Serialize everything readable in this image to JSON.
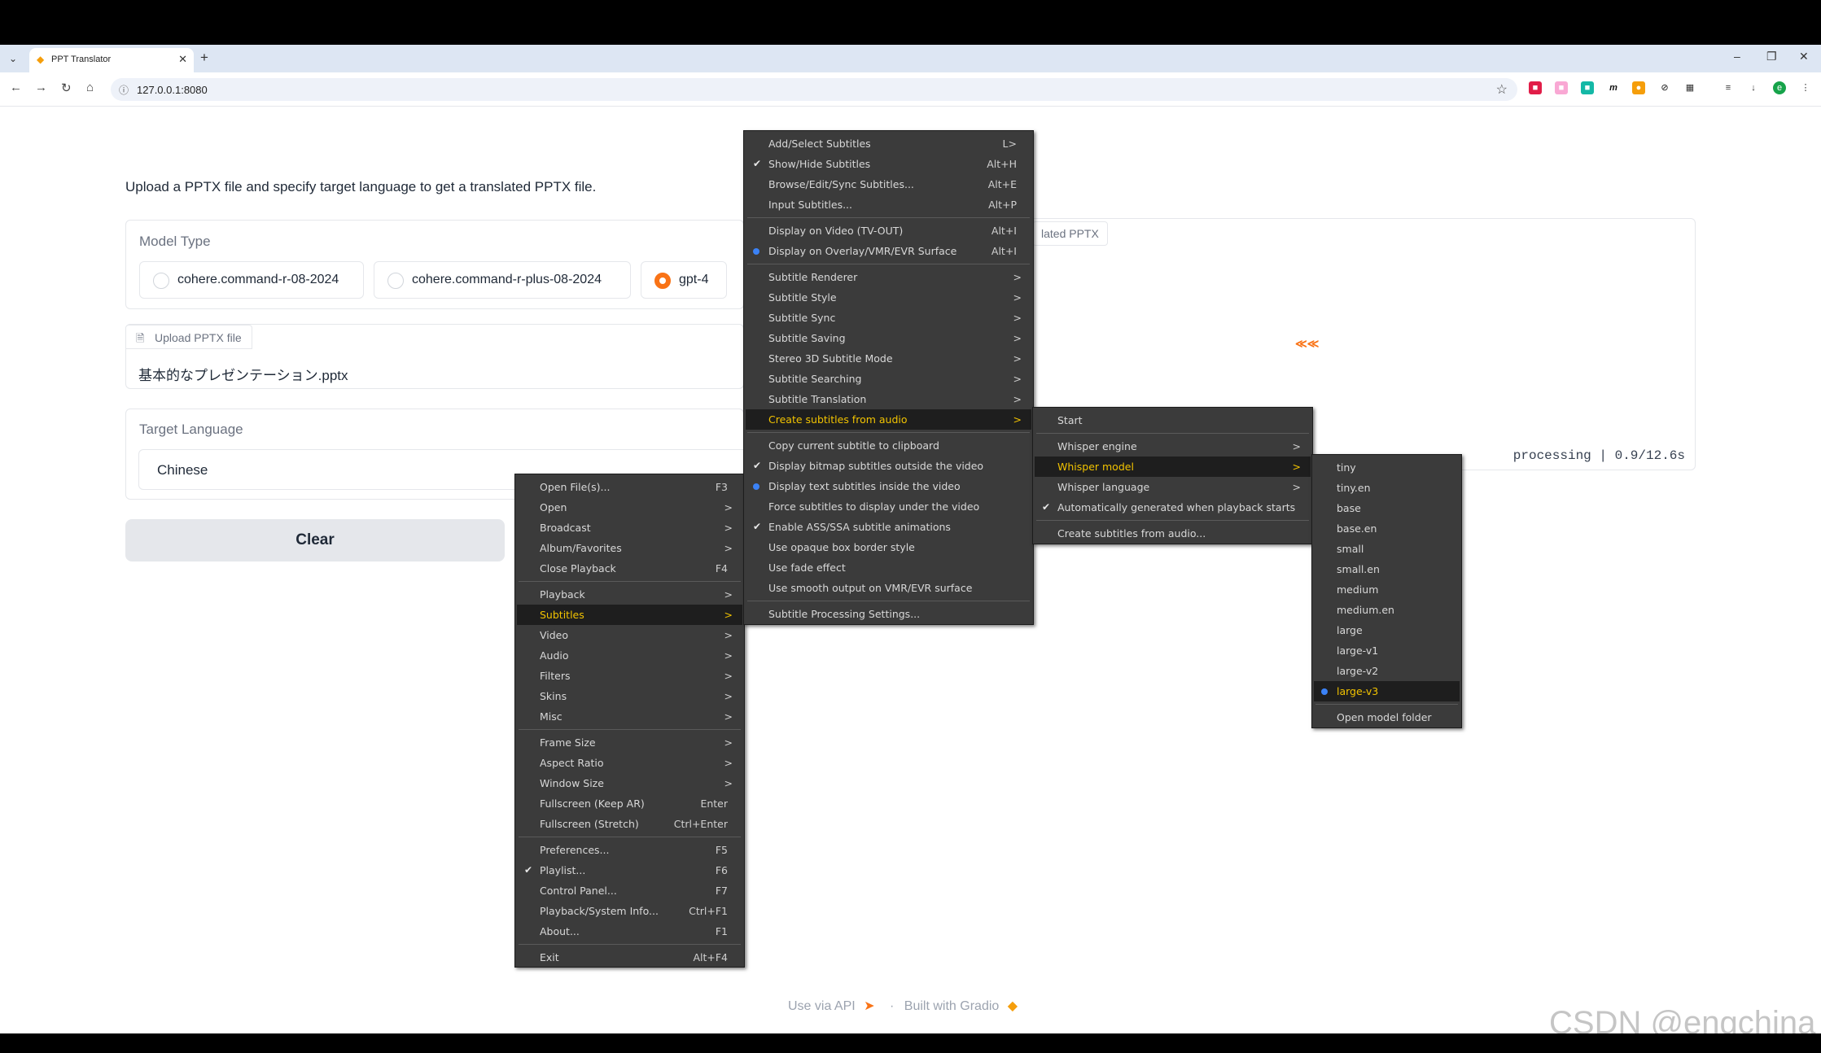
{
  "browser": {
    "tab_title": "PPT Translator",
    "url": "127.0.0.1:8080"
  },
  "page": {
    "description": "Upload a PPTX file and specify target language to get a translated PPTX file.",
    "model_type_label": "Model Type",
    "models": [
      "cohere.command-r-08-2024",
      "cohere.command-r-plus-08-2024",
      "gpt-4"
    ],
    "selected_model": "gpt-4",
    "upload_label": "Upload PPTX file",
    "file_name": "基本的なプレゼンテーション.pptx",
    "target_language_label": "Target Language",
    "target_language": "Chinese",
    "clear_label": "Clear",
    "output_label": "lated PPTX",
    "processing": "processing | 0.9/12.6s",
    "footer_api": "Use via API",
    "footer_sep": "·",
    "footer_built": "Built with Gradio",
    "watermark": "CSDN @engchina"
  },
  "main_menu": [
    {
      "label": "Open File(s)...",
      "shortcut": "F3"
    },
    {
      "label": "Open",
      "arrow": ">"
    },
    {
      "label": "Broadcast",
      "arrow": ">"
    },
    {
      "label": "Album/Favorites",
      "arrow": ">"
    },
    {
      "label": "Close Playback",
      "shortcut": "F4"
    },
    {
      "label": "Playback",
      "arrow": ">"
    },
    {
      "label": "Subtitles",
      "arrow": ">",
      "highlight": true
    },
    {
      "label": "Video",
      "arrow": ">"
    },
    {
      "label": "Audio",
      "arrow": ">"
    },
    {
      "label": "Filters",
      "arrow": ">"
    },
    {
      "label": "Skins",
      "arrow": ">"
    },
    {
      "label": "Misc",
      "arrow": ">"
    },
    {
      "label": "Frame Size",
      "arrow": ">"
    },
    {
      "label": "Aspect Ratio",
      "arrow": ">"
    },
    {
      "label": "Window Size",
      "arrow": ">"
    },
    {
      "label": "Fullscreen (Keep AR)",
      "shortcut": "Enter"
    },
    {
      "label": "Fullscreen (Stretch)",
      "shortcut": "Ctrl+Enter"
    },
    {
      "label": "Preferences...",
      "shortcut": "F5"
    },
    {
      "label": "Playlist...",
      "shortcut": "F6",
      "check": true
    },
    {
      "label": "Control Panel...",
      "shortcut": "F7"
    },
    {
      "label": "Playback/System Info...",
      "shortcut": "Ctrl+F1"
    },
    {
      "label": "About...",
      "shortcut": "F1"
    },
    {
      "label": "Exit",
      "shortcut": "Alt+F4"
    }
  ],
  "subtitles_menu": [
    {
      "label": "Add/Select Subtitles",
      "shortcut": "L>"
    },
    {
      "label": "Show/Hide Subtitles",
      "shortcut": "Alt+H",
      "check": true
    },
    {
      "label": "Browse/Edit/Sync Subtitles...",
      "shortcut": "Alt+E"
    },
    {
      "label": "Input Subtitles...",
      "shortcut": "Alt+P"
    },
    {
      "label": "Display on Video (TV-OUT)",
      "shortcut": "Alt+I"
    },
    {
      "label": "Display on Overlay/VMR/EVR Surface",
      "shortcut": "Alt+I",
      "dot": true
    },
    {
      "label": "Subtitle Renderer",
      "arrow": ">"
    },
    {
      "label": "Subtitle Style",
      "arrow": ">"
    },
    {
      "label": "Subtitle Sync",
      "arrow": ">"
    },
    {
      "label": "Subtitle Saving",
      "arrow": ">"
    },
    {
      "label": "Stereo 3D Subtitle Mode",
      "arrow": ">"
    },
    {
      "label": "Subtitle Searching",
      "arrow": ">"
    },
    {
      "label": "Subtitle Translation",
      "arrow": ">"
    },
    {
      "label": "Create subtitles from audio",
      "arrow": ">",
      "highlight": true
    },
    {
      "label": "Copy current subtitle to clipboard"
    },
    {
      "label": "Display bitmap subtitles outside the video",
      "check": true
    },
    {
      "label": "Display text subtitles inside the video",
      "dot": true
    },
    {
      "label": "Force subtitles to display under the video"
    },
    {
      "label": "Enable ASS/SSA subtitle animations",
      "check": true
    },
    {
      "label": "Use opaque box border style"
    },
    {
      "label": "Use fade effect"
    },
    {
      "label": "Use smooth output on VMR/EVR surface"
    },
    {
      "label": "Subtitle Processing Settings..."
    }
  ],
  "audio_menu": [
    {
      "label": "Start"
    },
    {
      "label": "Whisper engine",
      "arrow": ">"
    },
    {
      "label": "Whisper model",
      "arrow": ">",
      "highlight": true
    },
    {
      "label": "Whisper language",
      "arrow": ">"
    },
    {
      "label": "Automatically generated when playback starts",
      "check": true
    },
    {
      "label": "Create subtitles from audio..."
    }
  ],
  "model_menu": [
    {
      "label": "tiny"
    },
    {
      "label": "tiny.en"
    },
    {
      "label": "base"
    },
    {
      "label": "base.en"
    },
    {
      "label": "small"
    },
    {
      "label": "small.en"
    },
    {
      "label": "medium"
    },
    {
      "label": "medium.en"
    },
    {
      "label": "large"
    },
    {
      "label": "large-v1"
    },
    {
      "label": "large-v2"
    },
    {
      "label": "large-v3",
      "dot": true,
      "highlight": true
    },
    {
      "label": "Open model folder"
    }
  ]
}
